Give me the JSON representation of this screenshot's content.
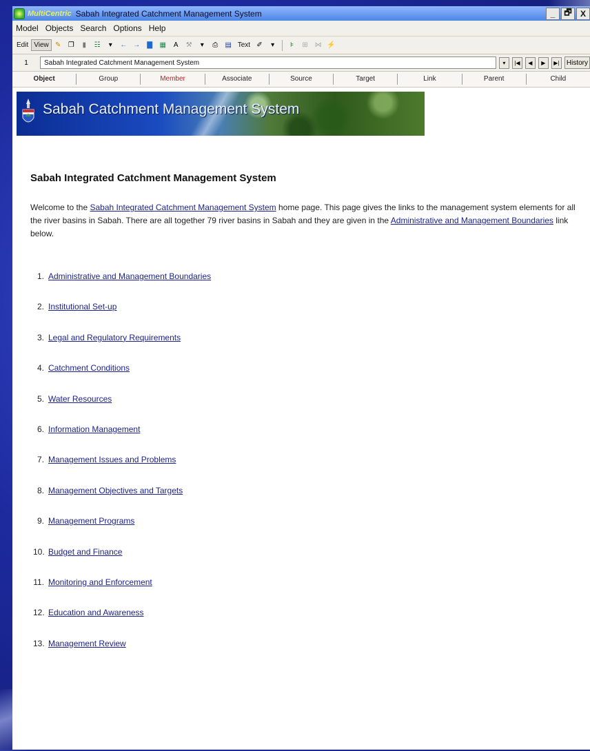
{
  "window": {
    "brand": "MultiCentric",
    "title": "Sabah Integrated Catchment Management System",
    "minimize": "_",
    "restore": "🗗",
    "close": "X"
  },
  "menu": [
    "Model",
    "Objects",
    "Search",
    "Options",
    "Help"
  ],
  "toolbar": {
    "edit": "Edit",
    "view": "View",
    "text_button": "Text"
  },
  "navbar": {
    "record_number": "1",
    "record_name": "Sabah Integrated Catchment Management System",
    "history": "History"
  },
  "tabs": [
    "Object",
    "Group",
    "Member",
    "Associate",
    "Source",
    "Target",
    "Link",
    "Parent",
    "Child"
  ],
  "banner": {
    "title": "Sabah Catchment Management System"
  },
  "page": {
    "title": "Sabah Integrated Catchment Management System",
    "intro_part1": "Welcome to the ",
    "intro_link1": "Sabah Integrated Catchment Management System",
    "intro_part2": " home page. This page gives the links to the management system elements for all the river basins in Sabah. There are all together 79 river basins in Sabah and they are given in the ",
    "intro_link2": "Administrative and Management Boundaries",
    "intro_part3": " link below."
  },
  "links": [
    {
      "num": "1.",
      "label": "Administrative and Management Boundaries"
    },
    {
      "num": "2.",
      "label": "Institutional Set-up"
    },
    {
      "num": "3.",
      "label": "Legal and Regulatory Requirements"
    },
    {
      "num": "4.",
      "label": "Catchment Conditions"
    },
    {
      "num": "5.",
      "label": "Water Resources"
    },
    {
      "num": "6.",
      "label": "Information Management"
    },
    {
      "num": "7.",
      "label": "Management Issues and Problems"
    },
    {
      "num": "8.",
      "label": "Management Objectives and Targets"
    },
    {
      "num": "9.",
      "label": "Management Programs"
    },
    {
      "num": "10.",
      "label": "Budget and Finance"
    },
    {
      "num": "11.",
      "label": "Monitoring and Enforcement"
    },
    {
      "num": "12.",
      "label": "Education and Awareness"
    },
    {
      "num": "13.",
      "label": "Management Review"
    }
  ],
  "colors": {
    "link": "#1a1f8a",
    "active_tab": "#b3232a",
    "titlebar": "#4d86e6"
  }
}
